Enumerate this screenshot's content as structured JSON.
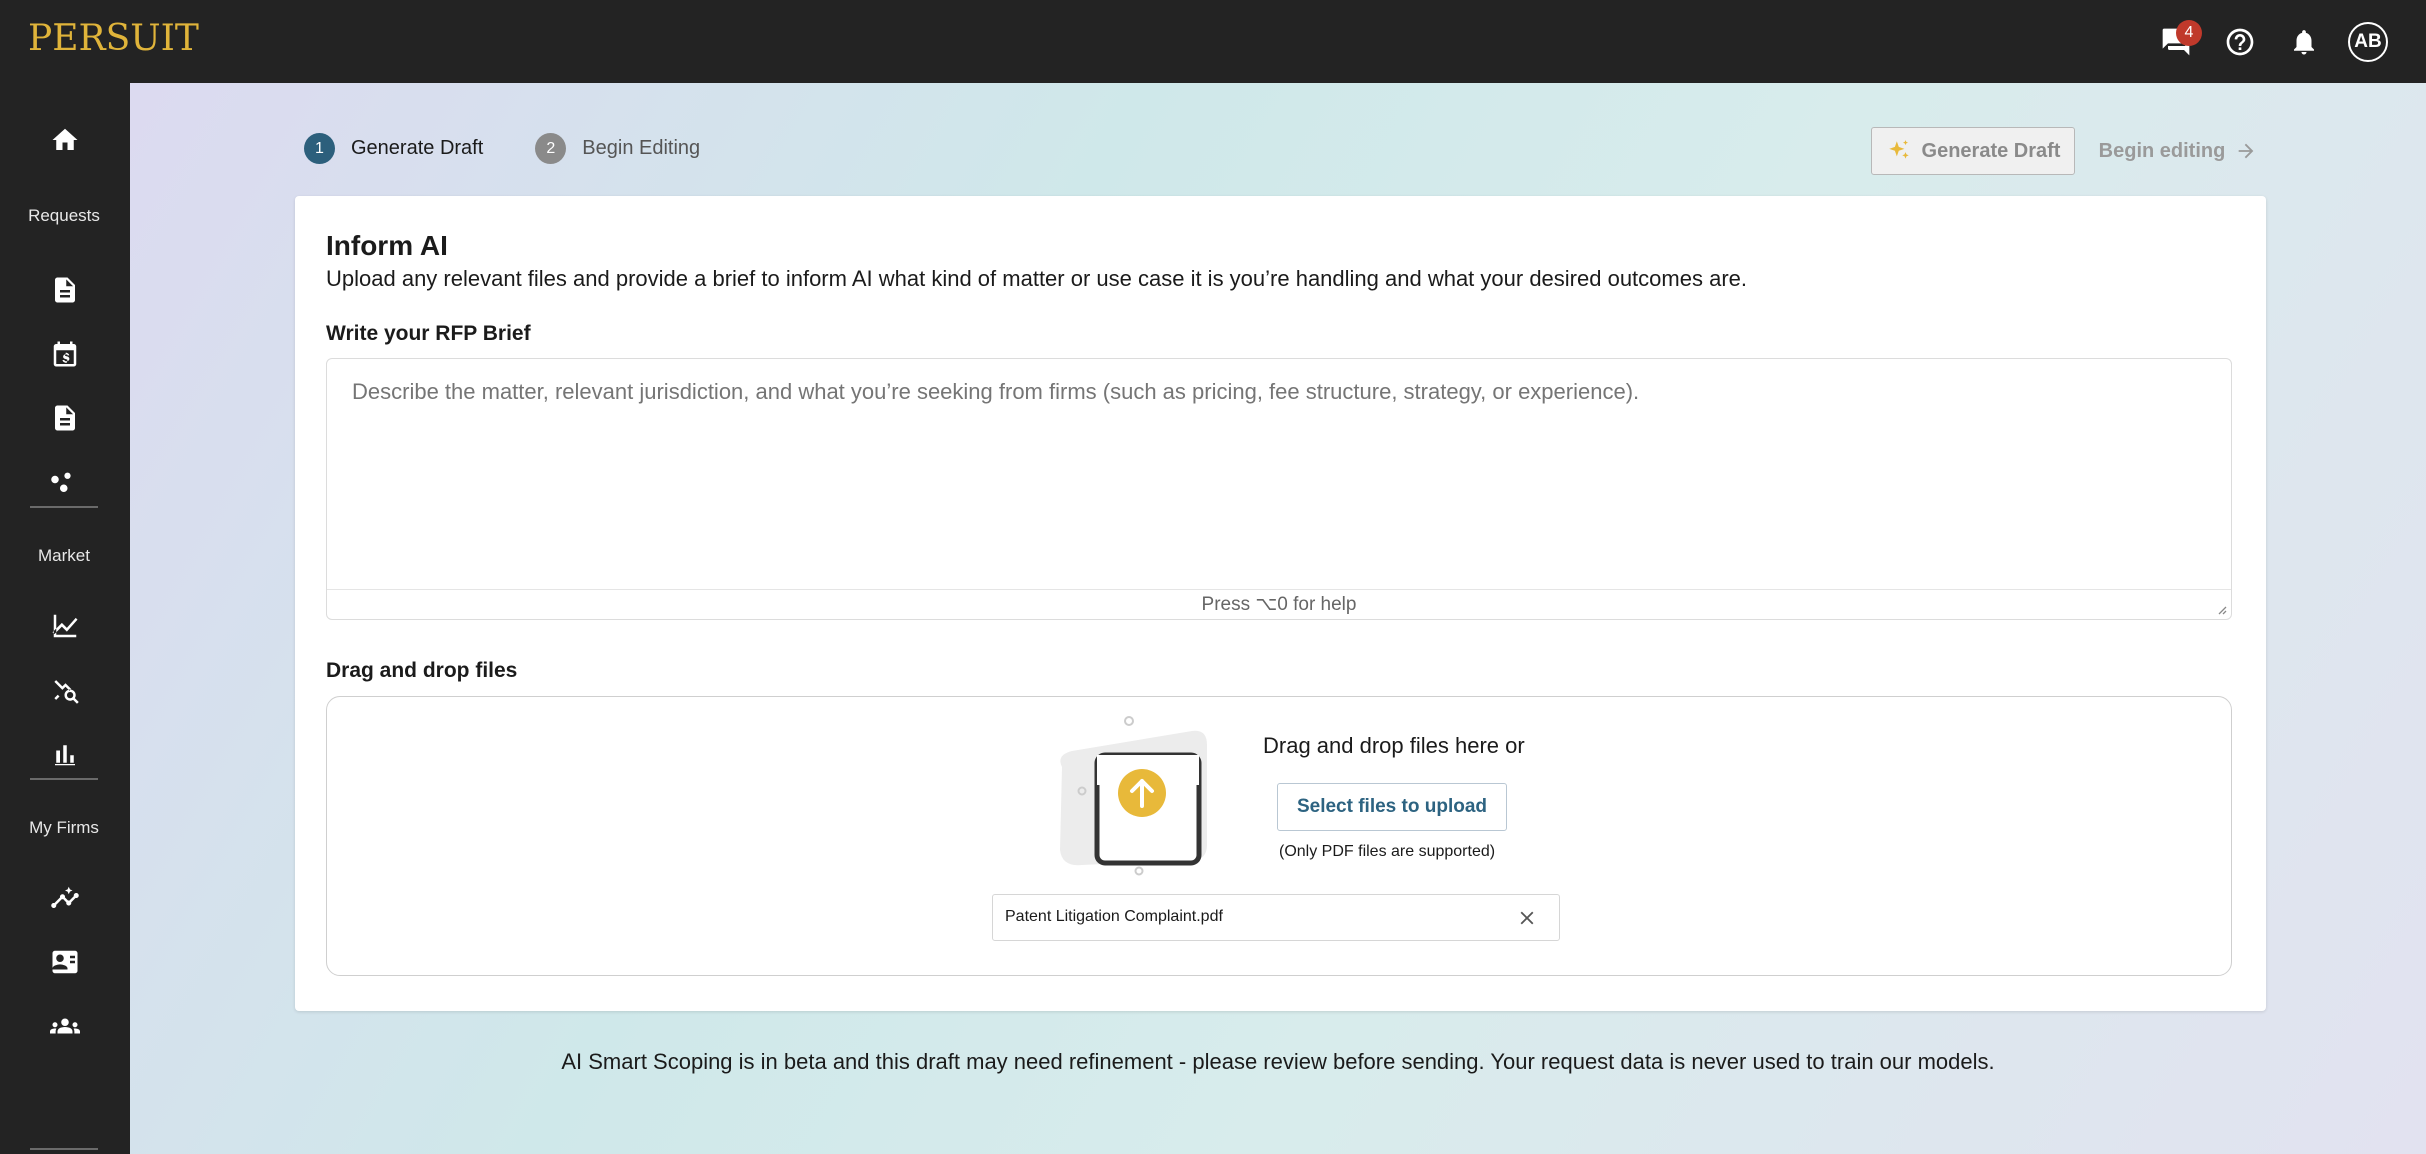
{
  "app": {
    "logo": "PERSUIT"
  },
  "topbar": {
    "messages_badge": "4",
    "avatar_initials": "AB"
  },
  "sidebar": {
    "sections": {
      "requests": "Requests",
      "market": "Market",
      "my_firms": "My Firms"
    }
  },
  "steps": [
    {
      "num": "1",
      "label": "Generate Draft"
    },
    {
      "num": "2",
      "label": "Begin Editing"
    }
  ],
  "actions": {
    "generate": "Generate Draft",
    "begin": "Begin editing"
  },
  "card": {
    "title": "Inform AI",
    "subtitle": "Upload any relevant files and provide a brief to inform AI what kind of matter or use case it is you’re handling and what your desired outcomes are.",
    "brief_label": "Write your RFP Brief",
    "brief_placeholder": "Describe the matter, relevant jurisdiction, and what you’re seeking from firms (such as pricing, fee structure, strategy, or experience).",
    "brief_help": "Press ⌥0 for help",
    "drop_label": "Drag and drop files",
    "drop_text": "Drag and drop files here or",
    "select_button": "Select files to upload",
    "drop_note": "(Only PDF files are supported)",
    "file_name": "Patent Litigation Complaint.pdf"
  },
  "disclaimer": "AI Smart Scoping is in beta and this draft may need refinement - please review before sending. Your request data is never used to train our models.",
  "colors": {
    "brand_gold": "#e0b43a",
    "step_active": "#2c5f7c",
    "step_inactive": "#8a8a8a",
    "primary_text": "#2d6381",
    "badge": "#c0392b"
  }
}
